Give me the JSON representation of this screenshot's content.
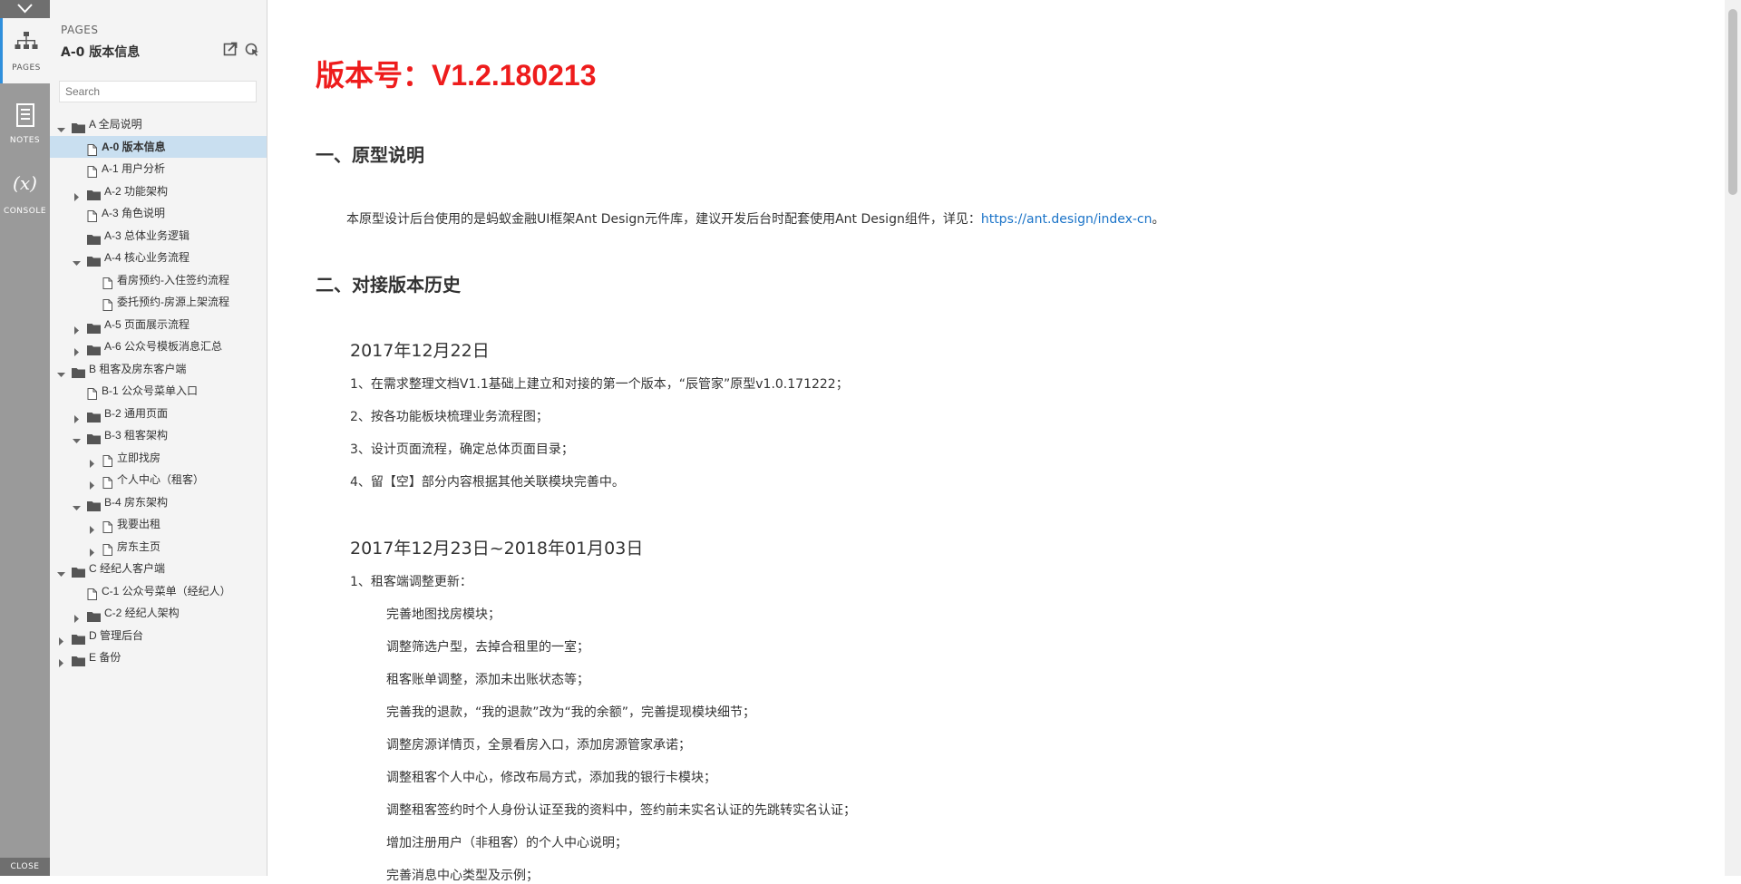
{
  "rail": {
    "tabs": [
      {
        "label": "PAGES",
        "icon": "sitemap-icon",
        "active": true
      },
      {
        "label": "NOTES",
        "icon": "notes-icon",
        "active": false
      },
      {
        "label": "CONSOLE",
        "icon": "variable-icon",
        "active": false
      }
    ],
    "close_label": "CLOSE"
  },
  "panel": {
    "header": "PAGES",
    "current_page": "A-0 版本信息",
    "search_placeholder": "Search",
    "tree": [
      {
        "label": "A 全局说明",
        "type": "folder",
        "level": 0,
        "arrow": "down"
      },
      {
        "label": "A-0 版本信息",
        "type": "page",
        "level": 1,
        "arrow": "none",
        "selected": true
      },
      {
        "label": "A-1 用户分析",
        "type": "page",
        "level": 1,
        "arrow": "none"
      },
      {
        "label": "A-2 功能架构",
        "type": "folder",
        "level": 1,
        "arrow": "right"
      },
      {
        "label": "A-3 角色说明",
        "type": "page",
        "level": 1,
        "arrow": "none"
      },
      {
        "label": "A-3 总体业务逻辑",
        "type": "folder",
        "level": 1,
        "arrow": "none"
      },
      {
        "label": "A-4 核心业务流程",
        "type": "folder",
        "level": 1,
        "arrow": "down"
      },
      {
        "label": "看房预约-入住签约流程",
        "type": "page",
        "level": 2,
        "arrow": "none"
      },
      {
        "label": "委托预约-房源上架流程",
        "type": "page",
        "level": 2,
        "arrow": "none"
      },
      {
        "label": "A-5 页面展示流程",
        "type": "folder",
        "level": 1,
        "arrow": "right"
      },
      {
        "label": "A-6 公众号模板消息汇总",
        "type": "folder",
        "level": 1,
        "arrow": "right"
      },
      {
        "label": "B 租客及房东客户端",
        "type": "folder",
        "level": 0,
        "arrow": "down"
      },
      {
        "label": "B-1 公众号菜单入口",
        "type": "page",
        "level": 1,
        "arrow": "none"
      },
      {
        "label": "B-2 通用页面",
        "type": "folder",
        "level": 1,
        "arrow": "right"
      },
      {
        "label": "B-3 租客架构",
        "type": "folder",
        "level": 1,
        "arrow": "down"
      },
      {
        "label": "立即找房",
        "type": "page",
        "level": 2,
        "arrow": "right"
      },
      {
        "label": "个人中心（租客）",
        "type": "page",
        "level": 2,
        "arrow": "right"
      },
      {
        "label": "B-4 房东架构",
        "type": "folder",
        "level": 1,
        "arrow": "down"
      },
      {
        "label": "我要出租",
        "type": "page",
        "level": 2,
        "arrow": "right"
      },
      {
        "label": "房东主页",
        "type": "page",
        "level": 2,
        "arrow": "right"
      },
      {
        "label": "C 经纪人客户端",
        "type": "folder",
        "level": 0,
        "arrow": "down"
      },
      {
        "label": "C-1 公众号菜单（经纪人）",
        "type": "page",
        "level": 1,
        "arrow": "none"
      },
      {
        "label": "C-2 经纪人架构",
        "type": "folder",
        "level": 1,
        "arrow": "right"
      },
      {
        "label": "D 管理后台",
        "type": "folder",
        "level": 0,
        "arrow": "right"
      },
      {
        "label": "E 备份",
        "type": "folder",
        "level": 0,
        "arrow": "right"
      }
    ]
  },
  "doc": {
    "version_title": "版本号：V1.2.180213",
    "section1_title": "一、原型说明",
    "section1_text": "本原型设计后台使用的是蚂蚁金融UI框架Ant Design元件库，建议开发后台时配套使用Ant Design组件，详见：",
    "section1_link": "https://ant.design/index-cn",
    "section1_tail": "。",
    "section2_title": "二、对接版本历史",
    "entry1_date": "2017年12月22日",
    "entry1_items": [
      "1、在需求整理文档V1.1基础上建立和对接的第一个版本，“辰管家”原型v1.0.171222；",
      "2、按各功能板块梳理业务流程图；",
      "3、设计页面流程，确定总体页面目录；",
      "4、留【空】部分内容根据其他关联模块完善中。"
    ],
    "entry2_date": "2017年12月23日~2018年01月03日",
    "entry2_head": "1、租客端调整更新：",
    "entry2_items": [
      "完善地图找房模块；",
      "调整筛选户型，去掉合租里的一室；",
      "租客账单调整，添加未出账状态等；",
      "完善我的退款，“我的退款”改为“我的余额”，完善提现模块细节；",
      "调整房源详情页，全景看房入口，添加房源管家承诺；",
      "调整租客个人中心，修改布局方式，添加我的银行卡模块；",
      "调整租客签约时个人身份认证至我的资料中，签约前未实名认证的先跳转实名认证；",
      "增加注册用户（非租客）的个人中心说明；",
      "完善消息中心类型及示例；"
    ]
  }
}
